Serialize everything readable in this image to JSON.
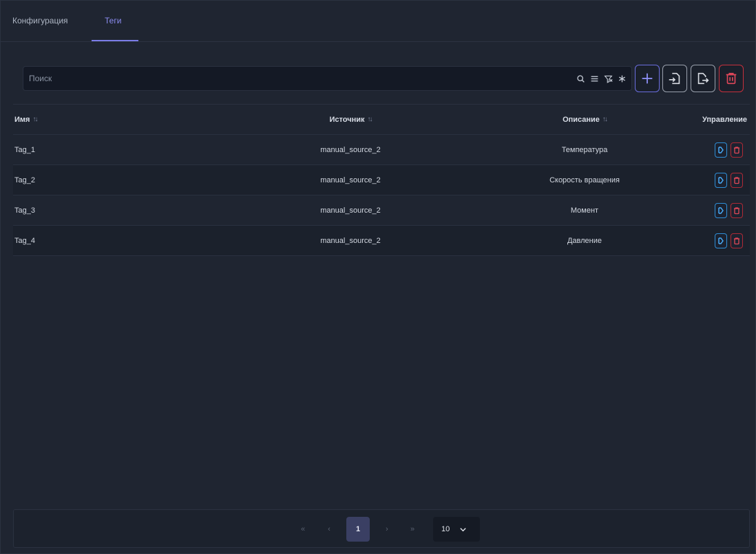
{
  "tabs": [
    {
      "label": "Конфигурация",
      "active": false
    },
    {
      "label": "Теги",
      "active": true
    }
  ],
  "search": {
    "placeholder": "Поиск",
    "value": ""
  },
  "search_icons": [
    "search-icon",
    "list-icon",
    "filter-icon",
    "asterisk-icon"
  ],
  "toolbar": {
    "add": "plus-icon",
    "import": "import-icon",
    "export": "export-icon",
    "delete": "trash-icon"
  },
  "table": {
    "columns": [
      "Имя",
      "Источник",
      "Описание",
      "Управление"
    ],
    "rows": [
      {
        "name": "Tag_1",
        "source": "manual_source_2",
        "description": "Температура"
      },
      {
        "name": "Tag_2",
        "source": "manual_source_2",
        "description": "Скорость вращения"
      },
      {
        "name": "Tag_3",
        "source": "manual_source_2",
        "description": "Момент"
      },
      {
        "name": "Tag_4",
        "source": "manual_source_2",
        "description": "Давление"
      }
    ]
  },
  "pagination": {
    "first": "«",
    "prev": "‹",
    "current_page": "1",
    "next": "›",
    "last": "»",
    "page_size": "10"
  },
  "colors": {
    "accent": "#7b7de8",
    "danger": "#e24a58",
    "edit": "#4ab0ff",
    "background": "#1f2531"
  }
}
